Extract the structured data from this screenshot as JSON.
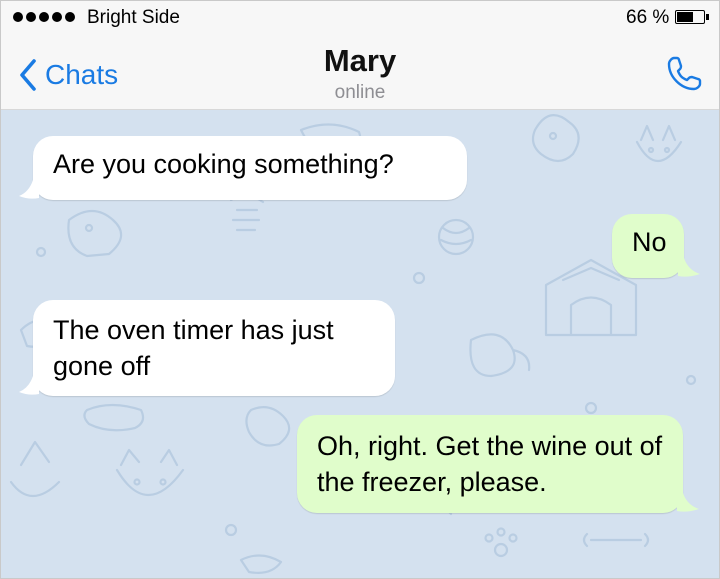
{
  "status_bar": {
    "carrier": "Bright Side",
    "battery_percent": "66 %",
    "battery_level": 0.66
  },
  "nav": {
    "back_label": "Chats",
    "contact_name": "Mary",
    "contact_status": "online",
    "back_icon": "chevron-left-icon",
    "call_icon": "phone-icon"
  },
  "colors": {
    "accent": "#1a7be3",
    "incoming_bubble": "#ffffff",
    "outgoing_bubble": "#e0fdcb",
    "chat_background": "#d4e1ef"
  },
  "messages": [
    {
      "direction": "incoming",
      "text": "Are you cooking something?"
    },
    {
      "direction": "outgoing",
      "text": "No"
    },
    {
      "direction": "incoming",
      "text": "The oven timer has just gone off"
    },
    {
      "direction": "outgoing",
      "text": "Oh, right. Get the wine out of the freezer, please."
    }
  ]
}
